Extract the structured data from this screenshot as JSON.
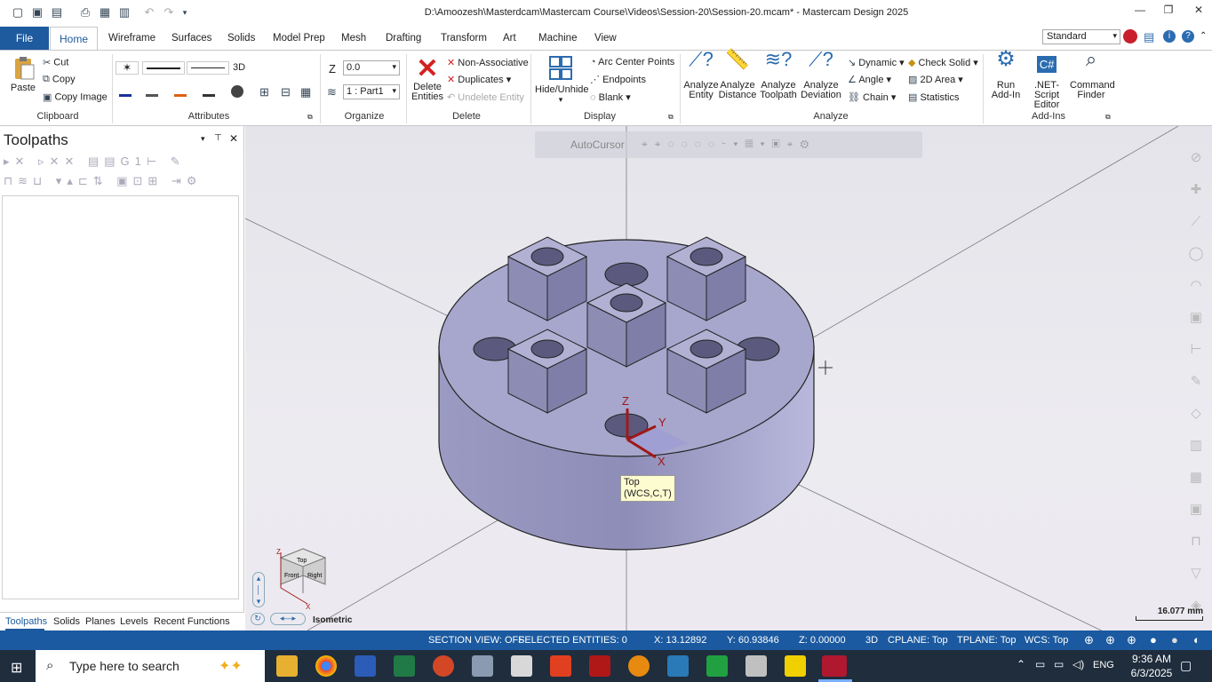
{
  "window": {
    "title": "D:\\Amoozesh\\Masterdcam\\Mastercam Course\\Videos\\Session-20\\Session-20.mcam* - Mastercam Design 2025"
  },
  "tabs": [
    "File",
    "Home",
    "Wireframe",
    "Surfaces",
    "Solids",
    "Model Prep",
    "Mesh",
    "Drafting",
    "Transform",
    "Art",
    "Machine",
    "View"
  ],
  "standard": "Standard",
  "ribbon": {
    "clipboard": {
      "paste": "Paste",
      "cut": "Cut",
      "copy": "Copy",
      "copy_image": "Copy Image",
      "label": "Clipboard"
    },
    "attributes": {
      "mode": "3D",
      "label": "Attributes"
    },
    "organize": {
      "z_label": "Z",
      "z_value": "0.0",
      "level": "1 : Part1",
      "label": "Organize"
    },
    "delete": {
      "delete_entities": "Delete Entities",
      "non_associative": "Non-Associative",
      "duplicates": "Duplicates",
      "undelete": "Undelete Entity",
      "label": "Delete"
    },
    "display": {
      "hide_unhide": "Hide/Unhide",
      "arc_center": "Arc Center Points",
      "endpoints": "Endpoints",
      "blank": "Blank",
      "label": "Display"
    },
    "analyze": {
      "entity": "Analyze Entity",
      "distance": "Analyze Distance",
      "toolpath": "Analyze Toolpath",
      "deviation": "Analyze Deviation",
      "dynamic": "Dynamic",
      "angle": "Angle",
      "chain": "Chain",
      "check_solid": "Check Solid",
      "area": "2D Area",
      "statistics": "Statistics",
      "label": "Analyze"
    },
    "addins": {
      "run": "Run Add-In",
      "net": ".NET-Script Editor",
      "command": "Command Finder",
      "label": "Add-Ins"
    }
  },
  "panel": {
    "title": "Toolpaths",
    "bottom_tabs": [
      "Toolpaths",
      "Solids",
      "Planes",
      "Levels",
      "Recent Functions"
    ]
  },
  "viewport": {
    "autocursor": "AutoCursor",
    "tooltip_line1": "Top",
    "tooltip_line2": "(WCS,C,T)",
    "axis_x": "X",
    "axis_y": "Y",
    "axis_z": "Z",
    "view_name": "Isometric",
    "scale": "16.077 mm",
    "cube_top": "Top",
    "cube_front": "Front",
    "cube_right": "Right"
  },
  "status": {
    "section": "SECTION VIEW: OFF",
    "selected": "SELECTED ENTITIES: 0",
    "x": "X:  13.12892",
    "y": "Y:  60.93846",
    "z": "Z:  0.00000",
    "mode": "3D",
    "cplane": "CPLANE: Top",
    "tplane": "TPLANE: Top",
    "wcs": "WCS: Top"
  },
  "taskbar": {
    "search": "Type here to search",
    "time": "9:36 AM",
    "date": "6/3/2025",
    "lang": "ENG"
  },
  "colors": {
    "accent": "#1b5aa0",
    "part": "#a7a6cc"
  }
}
